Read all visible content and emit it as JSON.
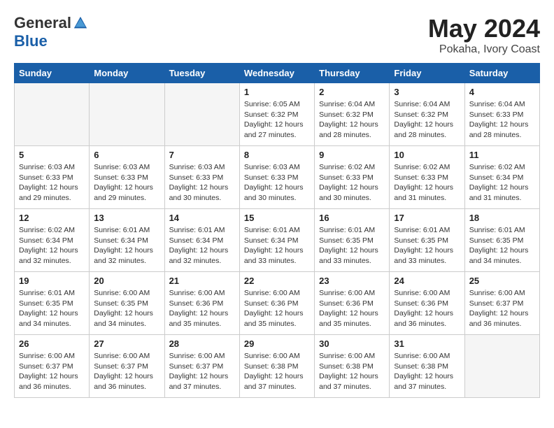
{
  "header": {
    "logo_general": "General",
    "logo_blue": "Blue",
    "month_year": "May 2024",
    "location": "Pokaha, Ivory Coast"
  },
  "days_of_week": [
    "Sunday",
    "Monday",
    "Tuesday",
    "Wednesday",
    "Thursday",
    "Friday",
    "Saturday"
  ],
  "weeks": [
    [
      {
        "day": "",
        "info": ""
      },
      {
        "day": "",
        "info": ""
      },
      {
        "day": "",
        "info": ""
      },
      {
        "day": "1",
        "info": "Sunrise: 6:05 AM\nSunset: 6:32 PM\nDaylight: 12 hours\nand 27 minutes."
      },
      {
        "day": "2",
        "info": "Sunrise: 6:04 AM\nSunset: 6:32 PM\nDaylight: 12 hours\nand 28 minutes."
      },
      {
        "day": "3",
        "info": "Sunrise: 6:04 AM\nSunset: 6:32 PM\nDaylight: 12 hours\nand 28 minutes."
      },
      {
        "day": "4",
        "info": "Sunrise: 6:04 AM\nSunset: 6:33 PM\nDaylight: 12 hours\nand 28 minutes."
      }
    ],
    [
      {
        "day": "5",
        "info": "Sunrise: 6:03 AM\nSunset: 6:33 PM\nDaylight: 12 hours\nand 29 minutes."
      },
      {
        "day": "6",
        "info": "Sunrise: 6:03 AM\nSunset: 6:33 PM\nDaylight: 12 hours\nand 29 minutes."
      },
      {
        "day": "7",
        "info": "Sunrise: 6:03 AM\nSunset: 6:33 PM\nDaylight: 12 hours\nand 30 minutes."
      },
      {
        "day": "8",
        "info": "Sunrise: 6:03 AM\nSunset: 6:33 PM\nDaylight: 12 hours\nand 30 minutes."
      },
      {
        "day": "9",
        "info": "Sunrise: 6:02 AM\nSunset: 6:33 PM\nDaylight: 12 hours\nand 30 minutes."
      },
      {
        "day": "10",
        "info": "Sunrise: 6:02 AM\nSunset: 6:33 PM\nDaylight: 12 hours\nand 31 minutes."
      },
      {
        "day": "11",
        "info": "Sunrise: 6:02 AM\nSunset: 6:34 PM\nDaylight: 12 hours\nand 31 minutes."
      }
    ],
    [
      {
        "day": "12",
        "info": "Sunrise: 6:02 AM\nSunset: 6:34 PM\nDaylight: 12 hours\nand 32 minutes."
      },
      {
        "day": "13",
        "info": "Sunrise: 6:01 AM\nSunset: 6:34 PM\nDaylight: 12 hours\nand 32 minutes."
      },
      {
        "day": "14",
        "info": "Sunrise: 6:01 AM\nSunset: 6:34 PM\nDaylight: 12 hours\nand 32 minutes."
      },
      {
        "day": "15",
        "info": "Sunrise: 6:01 AM\nSunset: 6:34 PM\nDaylight: 12 hours\nand 33 minutes."
      },
      {
        "day": "16",
        "info": "Sunrise: 6:01 AM\nSunset: 6:35 PM\nDaylight: 12 hours\nand 33 minutes."
      },
      {
        "day": "17",
        "info": "Sunrise: 6:01 AM\nSunset: 6:35 PM\nDaylight: 12 hours\nand 33 minutes."
      },
      {
        "day": "18",
        "info": "Sunrise: 6:01 AM\nSunset: 6:35 PM\nDaylight: 12 hours\nand 34 minutes."
      }
    ],
    [
      {
        "day": "19",
        "info": "Sunrise: 6:01 AM\nSunset: 6:35 PM\nDaylight: 12 hours\nand 34 minutes."
      },
      {
        "day": "20",
        "info": "Sunrise: 6:00 AM\nSunset: 6:35 PM\nDaylight: 12 hours\nand 34 minutes."
      },
      {
        "day": "21",
        "info": "Sunrise: 6:00 AM\nSunset: 6:36 PM\nDaylight: 12 hours\nand 35 minutes."
      },
      {
        "day": "22",
        "info": "Sunrise: 6:00 AM\nSunset: 6:36 PM\nDaylight: 12 hours\nand 35 minutes."
      },
      {
        "day": "23",
        "info": "Sunrise: 6:00 AM\nSunset: 6:36 PM\nDaylight: 12 hours\nand 35 minutes."
      },
      {
        "day": "24",
        "info": "Sunrise: 6:00 AM\nSunset: 6:36 PM\nDaylight: 12 hours\nand 36 minutes."
      },
      {
        "day": "25",
        "info": "Sunrise: 6:00 AM\nSunset: 6:37 PM\nDaylight: 12 hours\nand 36 minutes."
      }
    ],
    [
      {
        "day": "26",
        "info": "Sunrise: 6:00 AM\nSunset: 6:37 PM\nDaylight: 12 hours\nand 36 minutes."
      },
      {
        "day": "27",
        "info": "Sunrise: 6:00 AM\nSunset: 6:37 PM\nDaylight: 12 hours\nand 36 minutes."
      },
      {
        "day": "28",
        "info": "Sunrise: 6:00 AM\nSunset: 6:37 PM\nDaylight: 12 hours\nand 37 minutes."
      },
      {
        "day": "29",
        "info": "Sunrise: 6:00 AM\nSunset: 6:38 PM\nDaylight: 12 hours\nand 37 minutes."
      },
      {
        "day": "30",
        "info": "Sunrise: 6:00 AM\nSunset: 6:38 PM\nDaylight: 12 hours\nand 37 minutes."
      },
      {
        "day": "31",
        "info": "Sunrise: 6:00 AM\nSunset: 6:38 PM\nDaylight: 12 hours\nand 37 minutes."
      },
      {
        "day": "",
        "info": ""
      }
    ]
  ]
}
